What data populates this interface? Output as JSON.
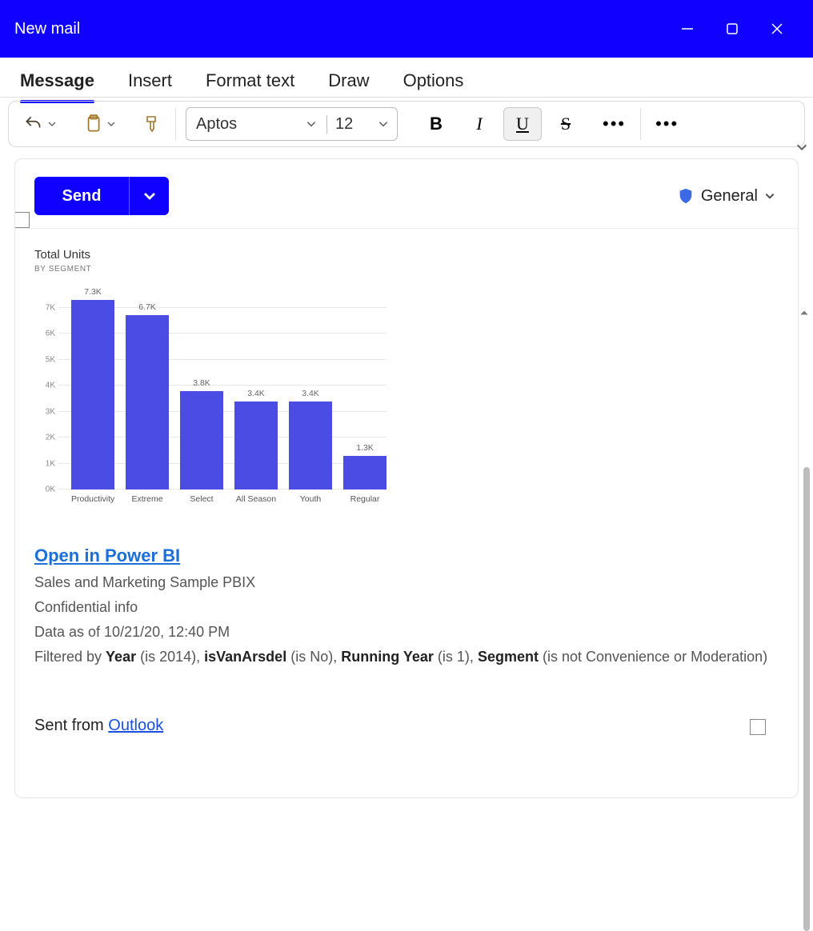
{
  "window": {
    "title": "New mail"
  },
  "tabs": [
    "Message",
    "Insert",
    "Format text",
    "Draw",
    "Options"
  ],
  "active_tab": 0,
  "ribbon": {
    "font_name": "Aptos",
    "font_size": "12"
  },
  "compose": {
    "send_label": "Send",
    "sensitivity_label": "General"
  },
  "body": {
    "link_text": "Open in Power BI",
    "report_name": "Sales and Marketing Sample PBIX",
    "classification": "Confidential info",
    "data_asof": "Data as of 10/21/20, 12:40 PM",
    "filter_prefix": "Filtered by ",
    "filters": [
      {
        "field": "Year",
        "cond": " (is 2014), "
      },
      {
        "field": "isVanArsdel",
        "cond": " (is No), "
      },
      {
        "field": "Running Year",
        "cond": " (is 1), "
      },
      {
        "field": "Segment",
        "cond": " (is not Convenience or Moderation)"
      }
    ],
    "signature_prefix": "Sent from ",
    "signature_link": "Outlook"
  },
  "chart_data": {
    "type": "bar",
    "title": "Total Units",
    "subtitle": "BY SEGMENT",
    "categories": [
      "Productivity",
      "Extreme",
      "Select",
      "All Season",
      "Youth",
      "Regular"
    ],
    "values": [
      7300,
      6700,
      3800,
      3400,
      3400,
      1300
    ],
    "value_labels": [
      "7.3K",
      "6.7K",
      "3.8K",
      "3.4K",
      "3.4K",
      "1.3K"
    ],
    "ylabel": "",
    "xlabel": "",
    "ylim": [
      0,
      8000
    ],
    "y_ticks": [
      0,
      1000,
      2000,
      3000,
      4000,
      5000,
      6000,
      7000
    ],
    "y_tick_labels": [
      "0K",
      "1K",
      "2K",
      "3K",
      "4K",
      "5K",
      "6K",
      "7K"
    ]
  }
}
